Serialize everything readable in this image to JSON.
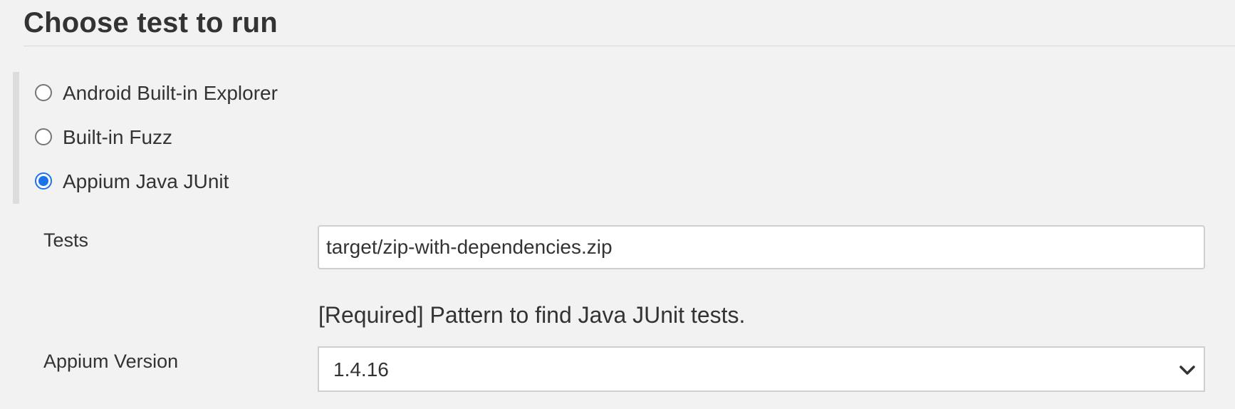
{
  "section": {
    "title": "Choose test to run"
  },
  "radio_options": [
    {
      "label": "Android Built-in Explorer",
      "checked": false
    },
    {
      "label": "Built-in Fuzz",
      "checked": false
    },
    {
      "label": "Appium Java JUnit",
      "checked": true
    }
  ],
  "tests_field": {
    "label": "Tests",
    "value": "target/zip-with-dependencies.zip",
    "help": "[Required] Pattern to find Java JUnit tests."
  },
  "appium_version": {
    "label": "Appium Version",
    "selected": "1.4.16"
  },
  "colors": {
    "accent": "#1a73e8",
    "background": "#f2f2f2",
    "text": "#333333"
  },
  "icons": {
    "select_arrow": "chevron-down-icon"
  }
}
